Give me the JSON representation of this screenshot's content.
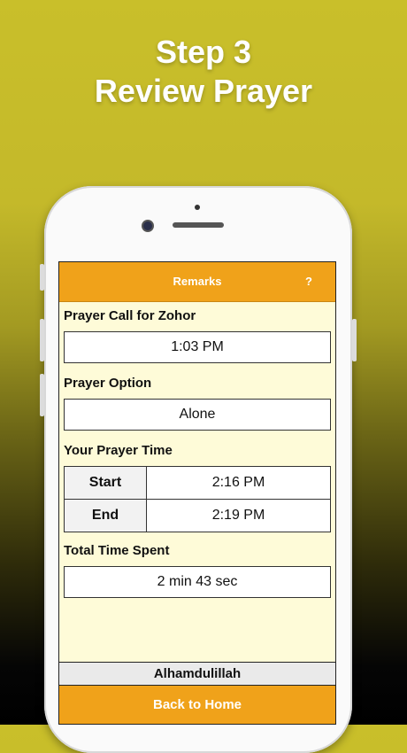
{
  "promo": {
    "line1": "Step 3",
    "line2": "Review Prayer"
  },
  "header": {
    "title": "Remarks",
    "help_label": "?"
  },
  "prayer_call": {
    "label": "Prayer Call for Zohor",
    "value": "1:03 PM"
  },
  "prayer_option": {
    "label": "Prayer Option",
    "value": "Alone"
  },
  "prayer_time": {
    "label": "Your Prayer Time",
    "rows": [
      {
        "key": "Start",
        "value": "2:16 PM"
      },
      {
        "key": "End",
        "value": "2:19 PM"
      }
    ]
  },
  "total_time": {
    "label": "Total Time Spent",
    "value": "2 min 43 sec"
  },
  "footer": {
    "message": "Alhamdulillah",
    "home_button": "Back to Home"
  },
  "colors": {
    "accent": "#f0a21a",
    "screen_bg": "#fefbd8",
    "bg_top": "#c9bf2a"
  }
}
